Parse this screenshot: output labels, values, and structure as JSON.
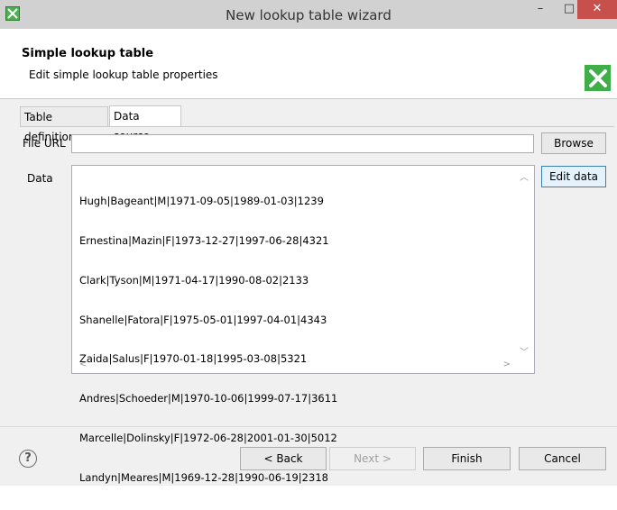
{
  "window": {
    "title": "New lookup table wizard",
    "minimize": "–",
    "maximize": "□",
    "close": "✕"
  },
  "header": {
    "title": "Simple lookup table",
    "description": "Edit simple lookup table properties"
  },
  "tabs": [
    {
      "label": "Table definition",
      "active": false
    },
    {
      "label": "Data source",
      "active": true
    }
  ],
  "form": {
    "file_url_label": "File URL",
    "file_url_value": "",
    "browse_label": "Browse",
    "data_label": "Data",
    "edit_data_label": "Edit data",
    "data_lines": [
      "Hugh|Bageant|M|1971-09-05|1989-01-03|1239",
      "Ernestina|Mazin|F|1973-12-27|1997-06-28|4321",
      "Clark|Tyson|M|1971-04-17|1990-08-02|2133",
      "Shanelle|Fatora|F|1975-05-01|1997-04-01|4343",
      "Zaida|Salus|F|1970-01-18|1995-03-08|5321",
      "Andres|Schoeder|M|1970-10-06|1999-07-17|3611",
      "Marcelle|Dolinsky|F|1972-06-28|2001-01-30|5012",
      "Landyn|Meares|M|1969-12-28|1990-06-19|2318"
    ]
  },
  "footer": {
    "help": "?",
    "back_label": "< Back",
    "next_label": "Next >",
    "finish_label": "Finish",
    "cancel_label": "Cancel"
  },
  "colors": {
    "close_button": "#c7504d",
    "logo_green": "#3fae49"
  }
}
